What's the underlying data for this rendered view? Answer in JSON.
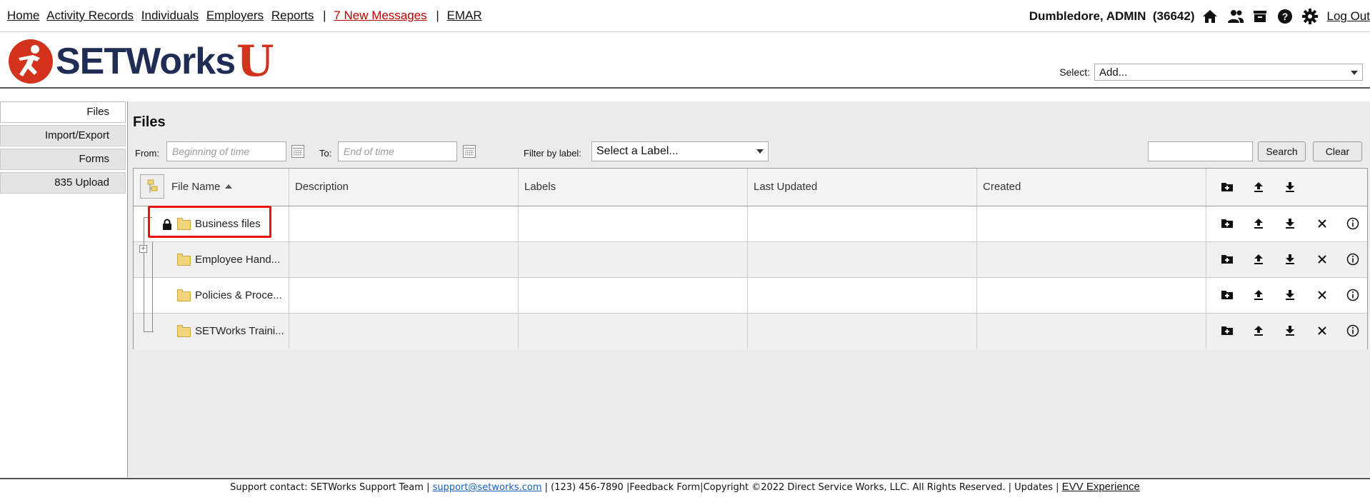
{
  "topnav": {
    "links": [
      "Home",
      "Activity Records",
      "Individuals",
      "Employers",
      "Reports"
    ],
    "separator": "|",
    "messages": "7 New Messages",
    "emar": "EMAR"
  },
  "user": {
    "name": "Dumbledore, ADMIN",
    "id": "(36642)",
    "logout": "Log Out",
    "icons": [
      "home-icon",
      "people-icon",
      "briefcase-icon",
      "help-icon",
      "gear-icon"
    ]
  },
  "brand": {
    "name": "SETWorks",
    "suffix": "U"
  },
  "header_select": {
    "label": "Select:",
    "value": "Add..."
  },
  "sidebar": {
    "items": [
      "Files",
      "Import/Export",
      "Forms",
      "835 Upload"
    ]
  },
  "page": {
    "title": "Files"
  },
  "filters": {
    "from_label": "From:",
    "from_placeholder": "Beginning of time",
    "to_label": "To:",
    "to_placeholder": "End of time",
    "label_filter": "Filter by label:",
    "label_select": "Select a Label...",
    "search_btn": "Search",
    "clear_btn": "Clear"
  },
  "grid": {
    "columns": [
      "File Name",
      "Description",
      "Labels",
      "Last Updated",
      "Created"
    ],
    "sort_column": "File Name",
    "rows": [
      {
        "name": "Business files",
        "description": "",
        "labels": "",
        "last_updated": "",
        "created": "",
        "locked": true
      },
      {
        "name": "Employee Hand...",
        "description": "",
        "labels": "",
        "last_updated": "",
        "created": "",
        "locked": false
      },
      {
        "name": "Policies & Proce...",
        "description": "",
        "labels": "",
        "last_updated": "",
        "created": "",
        "locked": false
      },
      {
        "name": "SETWorks Traini...",
        "description": "",
        "labels": "",
        "last_updated": "",
        "created": "",
        "locked": false
      }
    ]
  },
  "footer": {
    "support": "Support contact: SETWorks Support Team",
    "email": "support@setworks.com",
    "phone": "(123) 456-7890",
    "feedback": "Feedback Form",
    "copyright": "Copyright ©2022 Direct Service Works, LLC. All Rights Reserved.",
    "updates": "Updates",
    "evv": "EVV Experience"
  },
  "colors": {
    "brand_red": "#d3321d",
    "brand_navy": "#1f2d55",
    "highlight": "#ee1111",
    "link_red": "#bb0000"
  }
}
